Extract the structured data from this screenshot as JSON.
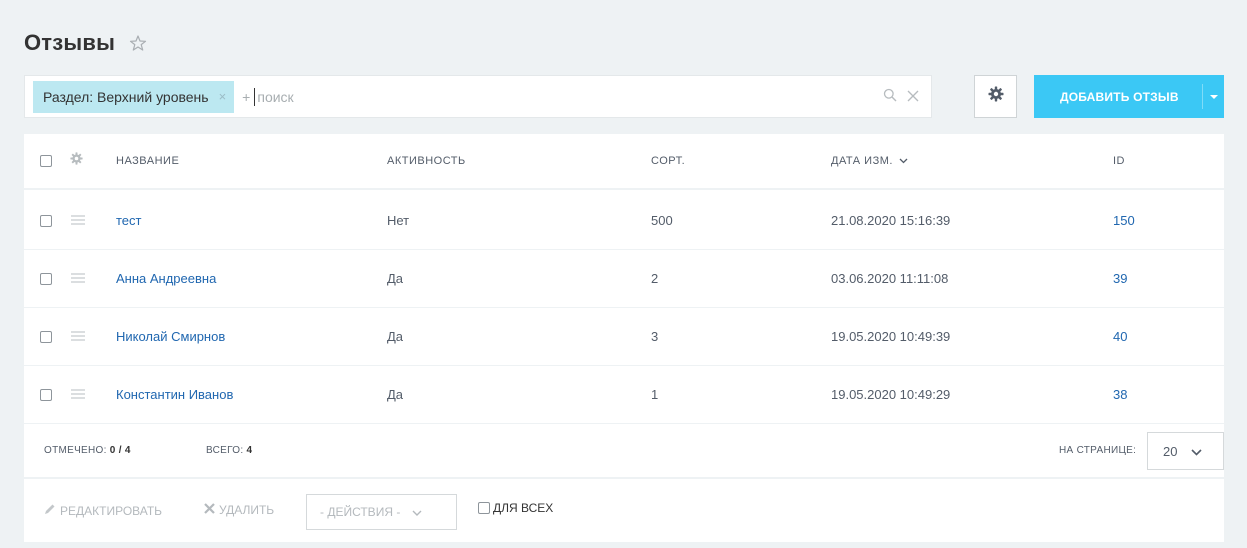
{
  "page": {
    "title": "Отзывы"
  },
  "filter": {
    "chip_label": "Раздел: Верхний уровень",
    "chip_remove": "×",
    "add_symbol": "+",
    "search_placeholder": "поиск",
    "search_value": ""
  },
  "toolbar": {
    "add_button_label": "ДОБАВИТЬ ОТЗЫВ"
  },
  "grid": {
    "columns": [
      "НАЗВАНИЕ",
      "АКТИВНОСТЬ",
      "СОРТ.",
      "ДАТА ИЗМ.",
      "ID"
    ],
    "rows": [
      {
        "name": "тест",
        "active": "Нет",
        "sort": "500",
        "date": "21.08.2020 15:16:39",
        "id": "150"
      },
      {
        "name": "Анна Андреевна",
        "active": "Да",
        "sort": "2",
        "date": "03.06.2020 11:11:08",
        "id": "39"
      },
      {
        "name": "Николай Смирнов",
        "active": "Да",
        "sort": "3",
        "date": "19.05.2020 10:49:39",
        "id": "40"
      },
      {
        "name": "Константин Иванов",
        "active": "Да",
        "sort": "1",
        "date": "19.05.2020 10:49:29",
        "id": "38"
      }
    ]
  },
  "footer": {
    "selected_label": "ОТМЕЧЕНО:",
    "selected_value": "0 / 4",
    "total_label": "ВСЕГО:",
    "total_value": "4",
    "per_page_label": "НА СТРАНИЦЕ:",
    "per_page_value": "20"
  },
  "actions": {
    "edit_label": "РЕДАКТИРОВАТЬ",
    "delete_label": "УДАЛИТЬ",
    "actions_dropdown": "- ДЕЙСТВИЯ -",
    "for_all_label": "ДЛЯ ВСЕХ"
  },
  "colors": {
    "accent": "#3bc8f5",
    "chip": "#bce8f1",
    "link": "#2067b0",
    "background": "#eef2f4"
  },
  "icons": {
    "title": "star-icon",
    "search": "search-icon",
    "clear": "close-icon",
    "settings": "gear-icon",
    "drag": "drag-handle-icon",
    "sort": "chevron-down-icon",
    "edit": "pencil-icon",
    "delete": "cross-icon"
  }
}
